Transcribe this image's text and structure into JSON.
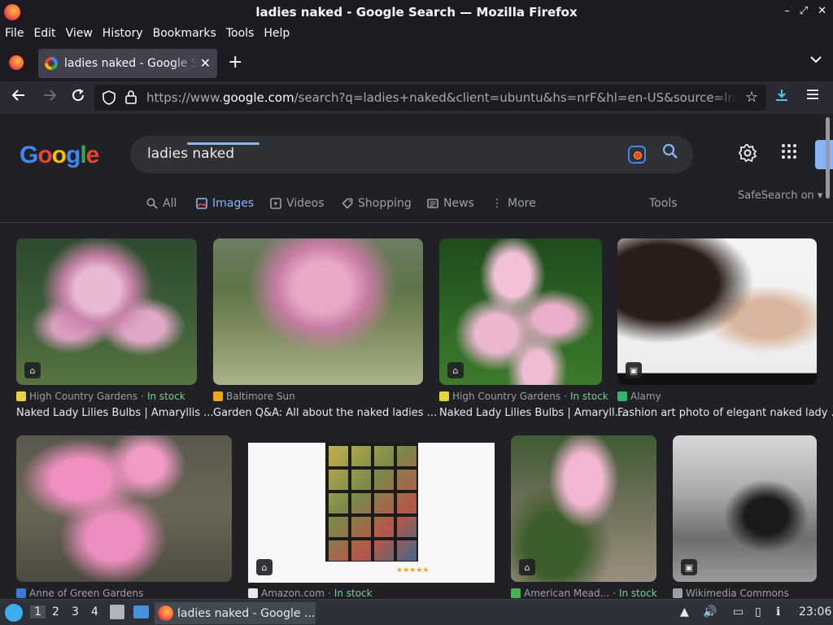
{
  "window": {
    "title": "ladies naked - Google Search — Mozilla Firefox",
    "controls": [
      "–",
      "⤢",
      "✕"
    ]
  },
  "menubar": [
    "File",
    "Edit",
    "View",
    "History",
    "Bookmarks",
    "Tools",
    "Help"
  ],
  "tab": {
    "label": "ladies naked - Google Se",
    "close": "✕",
    "new_tab": "+"
  },
  "nav": {
    "url_prefix": "https://www.",
    "url_domain": "google.com",
    "url_rest": "/search?q=ladies+naked&client=ubuntu&hs=nrF&hl=en-US&source=lnms&tbm"
  },
  "search": {
    "query": "ladies naked"
  },
  "filters": [
    {
      "label": "All",
      "icon": "search-icon",
      "glyph": "🔍"
    },
    {
      "label": "Images",
      "icon": "image-icon",
      "glyph": "🖼"
    },
    {
      "label": "Videos",
      "icon": "play-icon",
      "glyph": "▷"
    },
    {
      "label": "Shopping",
      "icon": "tag-icon",
      "glyph": "⌂"
    },
    {
      "label": "News",
      "icon": "news-icon",
      "glyph": "▤"
    },
    {
      "label": "More",
      "icon": "more-icon",
      "glyph": "⋮"
    }
  ],
  "tools_label": "Tools",
  "safesearch_label": "SafeSearch on",
  "results": [
    {
      "source": "High Country Gardens",
      "stock": "In stock",
      "title": "Naked Lady Lilies Bulbs | Amaryllis ...",
      "fav": "#e8d33f"
    },
    {
      "source": "Baltimore Sun",
      "stock": "",
      "title": "Garden Q&A: All about the naked ladies ...",
      "fav": "#f2a41d"
    },
    {
      "source": "High Country Gardens",
      "stock": "In stock",
      "title": "Naked Lady Lilies Bulbs | Amaryll...",
      "fav": "#e8d33f"
    },
    {
      "source": "Alamy",
      "stock": "",
      "title": "Fashion art photo of elegant naked lady ...",
      "fav": "#34b36b"
    },
    {
      "source": "Anne of Green Gardens",
      "stock": "",
      "title": "",
      "fav": "#3b7bd6"
    },
    {
      "source": "Amazon.com",
      "stock": "In stock",
      "title": "",
      "fav": "#e8eaed"
    },
    {
      "source": "American Mead...",
      "stock": "In stock",
      "title": "",
      "fav": "#4caf50"
    },
    {
      "source": "Wikimedia Commons",
      "stock": "",
      "title": "",
      "fav": "#9aa0a6"
    }
  ],
  "amazon_rating": "★★★★★",
  "taskbar": {
    "workspaces": [
      "1",
      "2",
      "3",
      "4"
    ],
    "task_label": "ladies naked - Google ...",
    "clock": "23:06"
  }
}
